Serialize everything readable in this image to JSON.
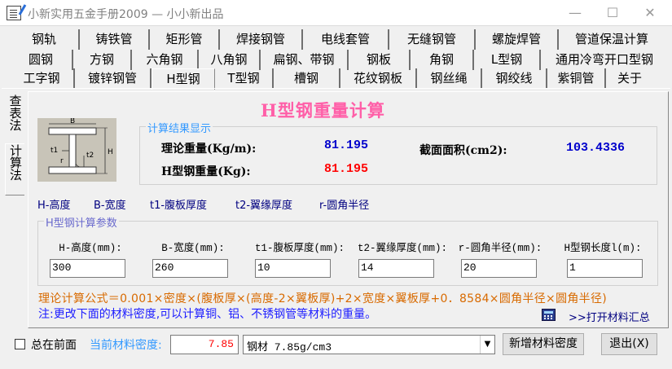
{
  "window": {
    "title": "小新实用五金手册2009 — 小小新出品"
  },
  "tabs_row1": [
    "钢轨",
    "铸铁管",
    "矩形管",
    "焊接钢管",
    "电线套管",
    "无缝钢管",
    "螺旋焊管",
    "管道保温计算"
  ],
  "tabs_row2": [
    "圆钢",
    "方钢",
    "六角钢",
    "八角钢",
    "扁钢、带钢",
    "钢板",
    "角钢",
    "L型钢",
    "通用冷弯开口型钢"
  ],
  "tabs_row3": [
    "工字钢",
    "镀锌钢管",
    "H型钢",
    "T型钢",
    "槽钢",
    "花纹钢板",
    "钢丝绳",
    "钢绞线",
    "紫铜管",
    "关于"
  ],
  "side_tabs": [
    "查表法",
    "计算法"
  ],
  "heading": "H型钢重量计算",
  "diagram": {
    "b": "B",
    "h": "H",
    "t1": "t1",
    "t2": "t2",
    "r": "r"
  },
  "results": {
    "legend": "计算结果显示",
    "theory_weight_label": "理论重量(Kg/m):",
    "theory_weight_value": "81.195",
    "area_label": "截面面积(cm2):",
    "area_value": "103.4336",
    "total_weight_label": "H型钢重量(Kg):",
    "total_weight_value": "81.195"
  },
  "symbol_legend": [
    "H-高度",
    "B-宽度",
    "t1-腹板厚度",
    "t2-翼缘厚度",
    "r-圆角半径"
  ],
  "params": {
    "legend": "H型钢计算参数",
    "fields": [
      {
        "label": "H-高度(mm):",
        "value": "300"
      },
      {
        "label": "B-宽度(mm):",
        "value": "260"
      },
      {
        "label": "t1-腹板厚度(mm):",
        "value": "10"
      },
      {
        "label": "t2-翼缘厚度(mm):",
        "value": "14"
      },
      {
        "label": "r-圆角半径(mm):",
        "value": "20"
      },
      {
        "label": "H型钢长度l(m):",
        "value": "1"
      }
    ]
  },
  "formula": "理论计算公式＝0.001×密度×(腹板厚×(高度-2×翼板厚)+2×宽度×翼板厚+0．8584×圆角半径×圆角半径)",
  "note": "注:更改下面的材料密度,可以计算铜、铝、不锈钢管等材料的重量。",
  "summary_link": ">>打开材料汇总",
  "bottom": {
    "always_on_top": "总在前面",
    "density_label": "当前材料密度:",
    "density_value": "7.85",
    "material_select": "钢材 7.85g/cm3",
    "add_density_button": "新增材料密度",
    "exit_button": "退出(X)"
  },
  "colors": {
    "heading": "#ff5fa8",
    "blue_value": "#0000cc",
    "red_value": "#ff0000",
    "formula": "#d86a00",
    "note": "#2020ff",
    "density_value": "#ff0000",
    "legend_blue": "#3399ff"
  },
  "icons": [
    "app-notepad-icon",
    "minimize-icon",
    "maximize-icon",
    "close-icon",
    "calculator-icon",
    "dropdown-arrow-icon"
  ]
}
